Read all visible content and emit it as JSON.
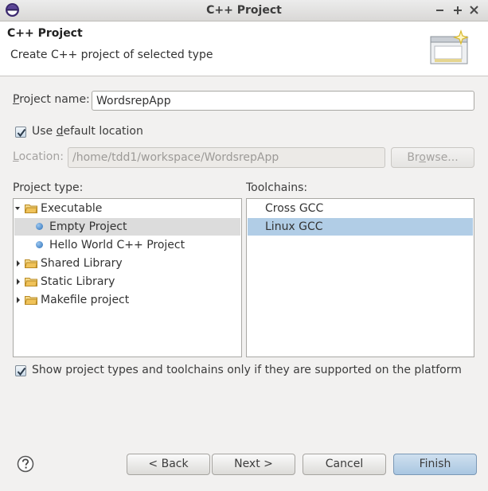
{
  "window": {
    "title": "C++ Project"
  },
  "banner": {
    "title": "C++ Project",
    "description": "Create C++ project of selected type"
  },
  "project_name": {
    "label_pre": "P",
    "label_rest": "roject name:",
    "value": "WordsrepApp"
  },
  "use_default_location": {
    "checked": true,
    "label_pre": "Use ",
    "label_u": "d",
    "label_rest": "efault location"
  },
  "location": {
    "label_pre": "L",
    "label_rest": "ocation:",
    "value": "/home/tdd1/workspace/WordsrepApp",
    "browse_label_pre": "Br",
    "browse_label_u": "o",
    "browse_label_rest": "wse..."
  },
  "project_type": {
    "label": "Project type:",
    "items": [
      {
        "label": "Executable",
        "kind": "folder",
        "expanded": true
      },
      {
        "label": "Empty Project",
        "kind": "leaf",
        "selected": true
      },
      {
        "label": "Hello World C++ Project",
        "kind": "leaf"
      },
      {
        "label": "Shared Library",
        "kind": "folder",
        "expanded": false
      },
      {
        "label": "Static Library",
        "kind": "folder",
        "expanded": false
      },
      {
        "label": "Makefile project",
        "kind": "folder",
        "expanded": false
      }
    ]
  },
  "toolchains": {
    "label": "Toolchains:",
    "items": [
      {
        "label": "Cross GCC"
      },
      {
        "label": "Linux GCC",
        "selected": true
      }
    ]
  },
  "show_supported": {
    "checked": true,
    "label": "Show project types and toolchains only if they are supported on the platform"
  },
  "buttons": {
    "back": "< Back",
    "next": "Next >",
    "cancel": "Cancel",
    "finish": "Finish"
  },
  "colors": {
    "selection_blue": "#b1cde6",
    "selection_gray": "#dcdcdc",
    "folder": "#e9c56a"
  },
  "icons": {
    "help": "question-circle-icon",
    "app": "eclipse-icon"
  }
}
